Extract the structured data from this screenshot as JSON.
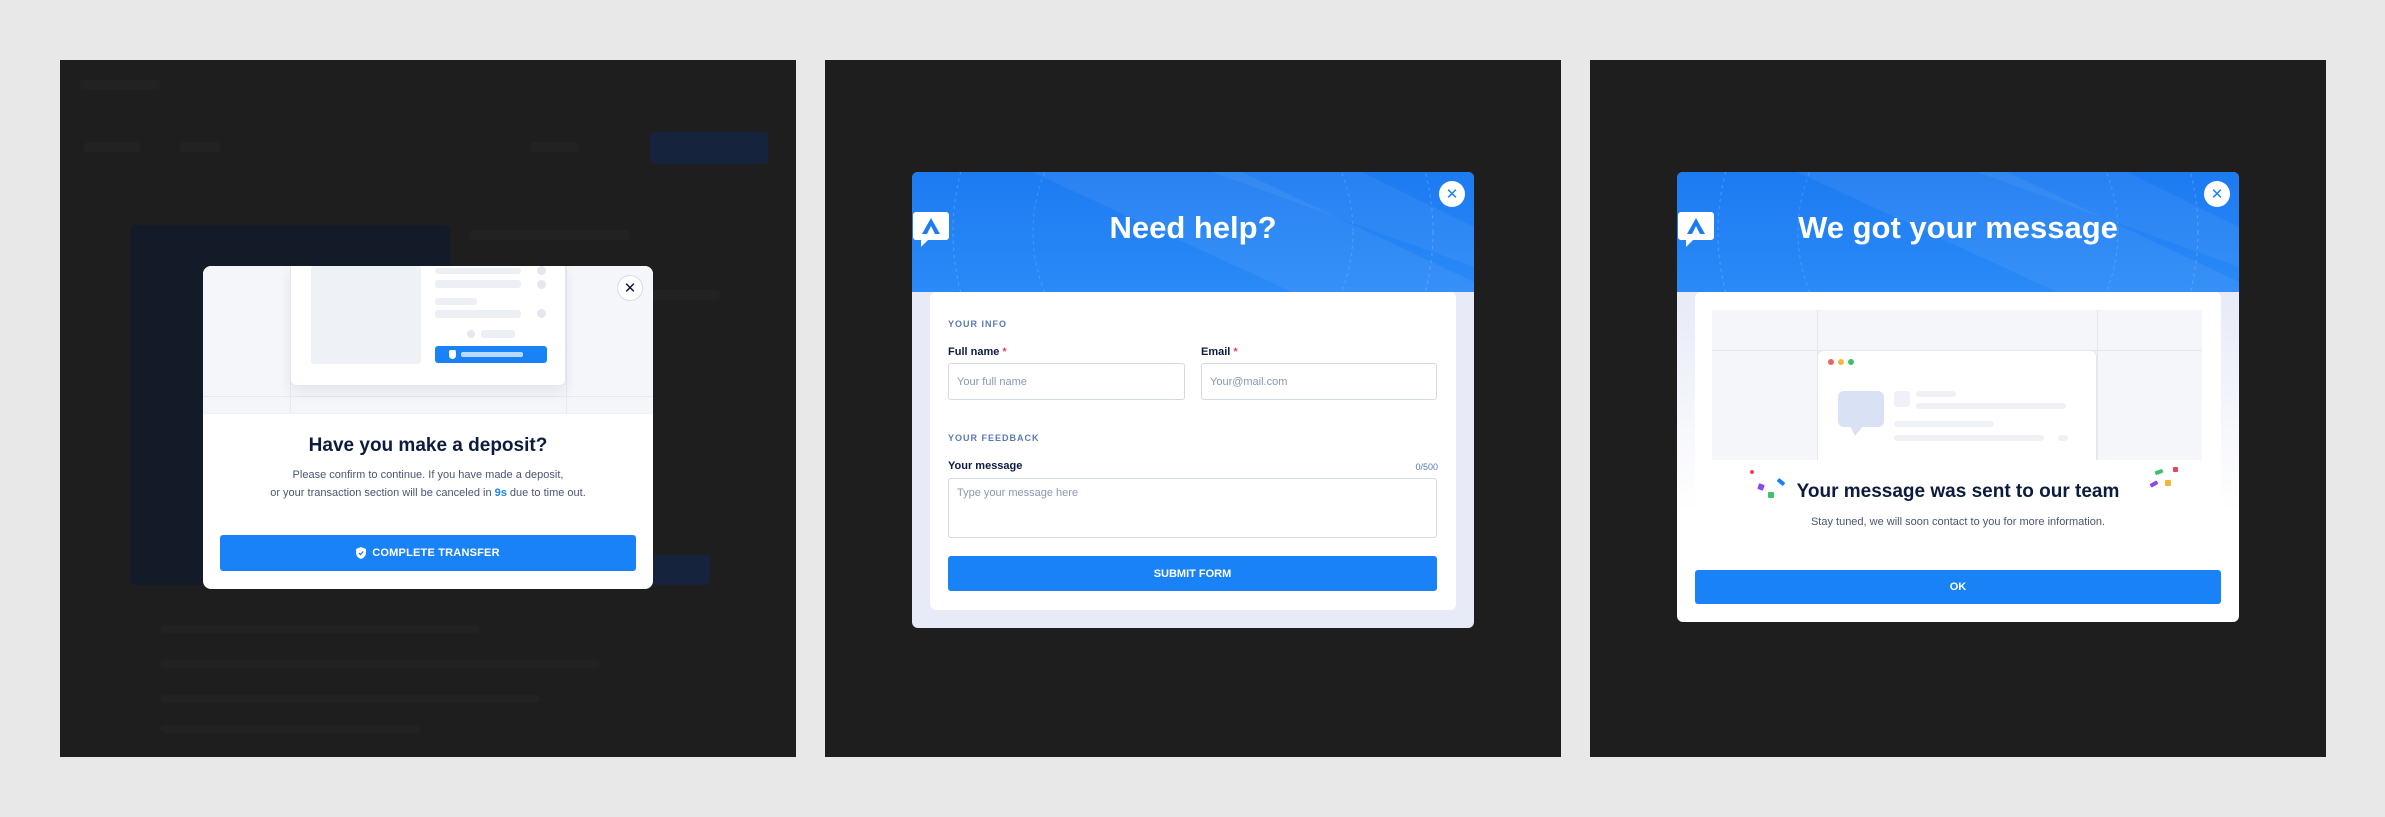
{
  "deposit_modal": {
    "title": "Have you make a deposit?",
    "description_line1": "Please confirm to continue. If you have made a deposit,",
    "description_line2_before": "or your transaction section will be canceled in ",
    "countdown": "9s",
    "description_line2_after": " due to time out.",
    "button_label": "COMPLETE TRANSFER",
    "close_label": "✕"
  },
  "help_modal": {
    "title": "Need help?",
    "close_label": "✕",
    "info_section": "YOUR INFO",
    "full_name_label": "Full name",
    "full_name_placeholder": "Your full name",
    "email_label": "Email",
    "email_placeholder": "Your@mail.com",
    "required_mark": "*",
    "feedback_section": "YOUR FEEDBACK",
    "message_label": "Your message",
    "message_counter": "0/500",
    "message_placeholder": "Type your message here",
    "submit_label": "SUBMIT FORM"
  },
  "confirm_modal": {
    "title": "We got your message",
    "close_label": "✕",
    "sent_title": "Your message was sent to our team",
    "sent_description": "Stay tuned, we will soon contact to you for more information.",
    "ok_label": "OK"
  },
  "colors": {
    "primary": "#1a82f7",
    "background": "#e8e8e8",
    "panel": "#1e1e1e",
    "required": "#e8455b"
  },
  "icons": [
    "close-icon",
    "shield-icon",
    "brand-logo-icon",
    "chat-bubble-icon"
  ]
}
